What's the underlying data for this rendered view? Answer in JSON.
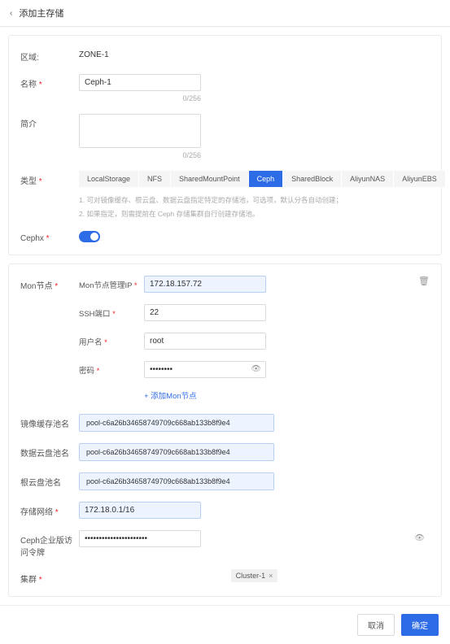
{
  "header": {
    "title": "添加主存储"
  },
  "section1": {
    "zone": {
      "label": "区域:",
      "value": "ZONE-1"
    },
    "name": {
      "label": "名称",
      "value": "Ceph-1",
      "counter": "0/256"
    },
    "intro": {
      "label": "简介",
      "value": "",
      "counter": "0/256"
    },
    "type": {
      "label": "类型",
      "tabs": [
        "LocalStorage",
        "NFS",
        "SharedMountPoint",
        "Ceph",
        "SharedBlock",
        "AliyunNAS",
        "AliyunEBS"
      ],
      "hint1": "1. 可对镜像缓存、根云盘、数据云盘指定特定的存储池，可选项，默认分各自动创建；",
      "hint2": "2. 如果指定，则需提前在 Ceph 存储集群自行创建存储池。"
    },
    "cephx": {
      "label": "Cephx"
    }
  },
  "section2": {
    "mon": {
      "label": "Mon节点",
      "ip": {
        "label": "Mon节点管理IP",
        "value": "172.18.157.72"
      },
      "ssh": {
        "label": "SSH端口",
        "value": "22"
      },
      "user": {
        "label": "用户名",
        "value": "root"
      },
      "pass": {
        "label": "密码",
        "value": "••••••••"
      },
      "add": "+ 添加Mon节点"
    },
    "pools": {
      "imgcache": {
        "label": "镜像缓存池名",
        "value": "pool-c6a26b34658749709c668ab133b8f9e4"
      },
      "datadisk": {
        "label": "数据云盘池名",
        "value": "pool-c6a26b34658749709c668ab133b8f9e4"
      },
      "rootdisk": {
        "label": "根云盘池名",
        "value": "pool-c6a26b34658749709c668ab133b8f9e4"
      }
    },
    "net": {
      "label": "存储网络",
      "value": "172.18.0.1/16"
    },
    "token": {
      "label": "Ceph企业版访问令牌",
      "value": "••••••••••••••••••••••"
    },
    "cluster": {
      "label": "集群",
      "chip": "Cluster-1"
    }
  },
  "footer": {
    "cancel": "取消",
    "ok": "确定"
  }
}
